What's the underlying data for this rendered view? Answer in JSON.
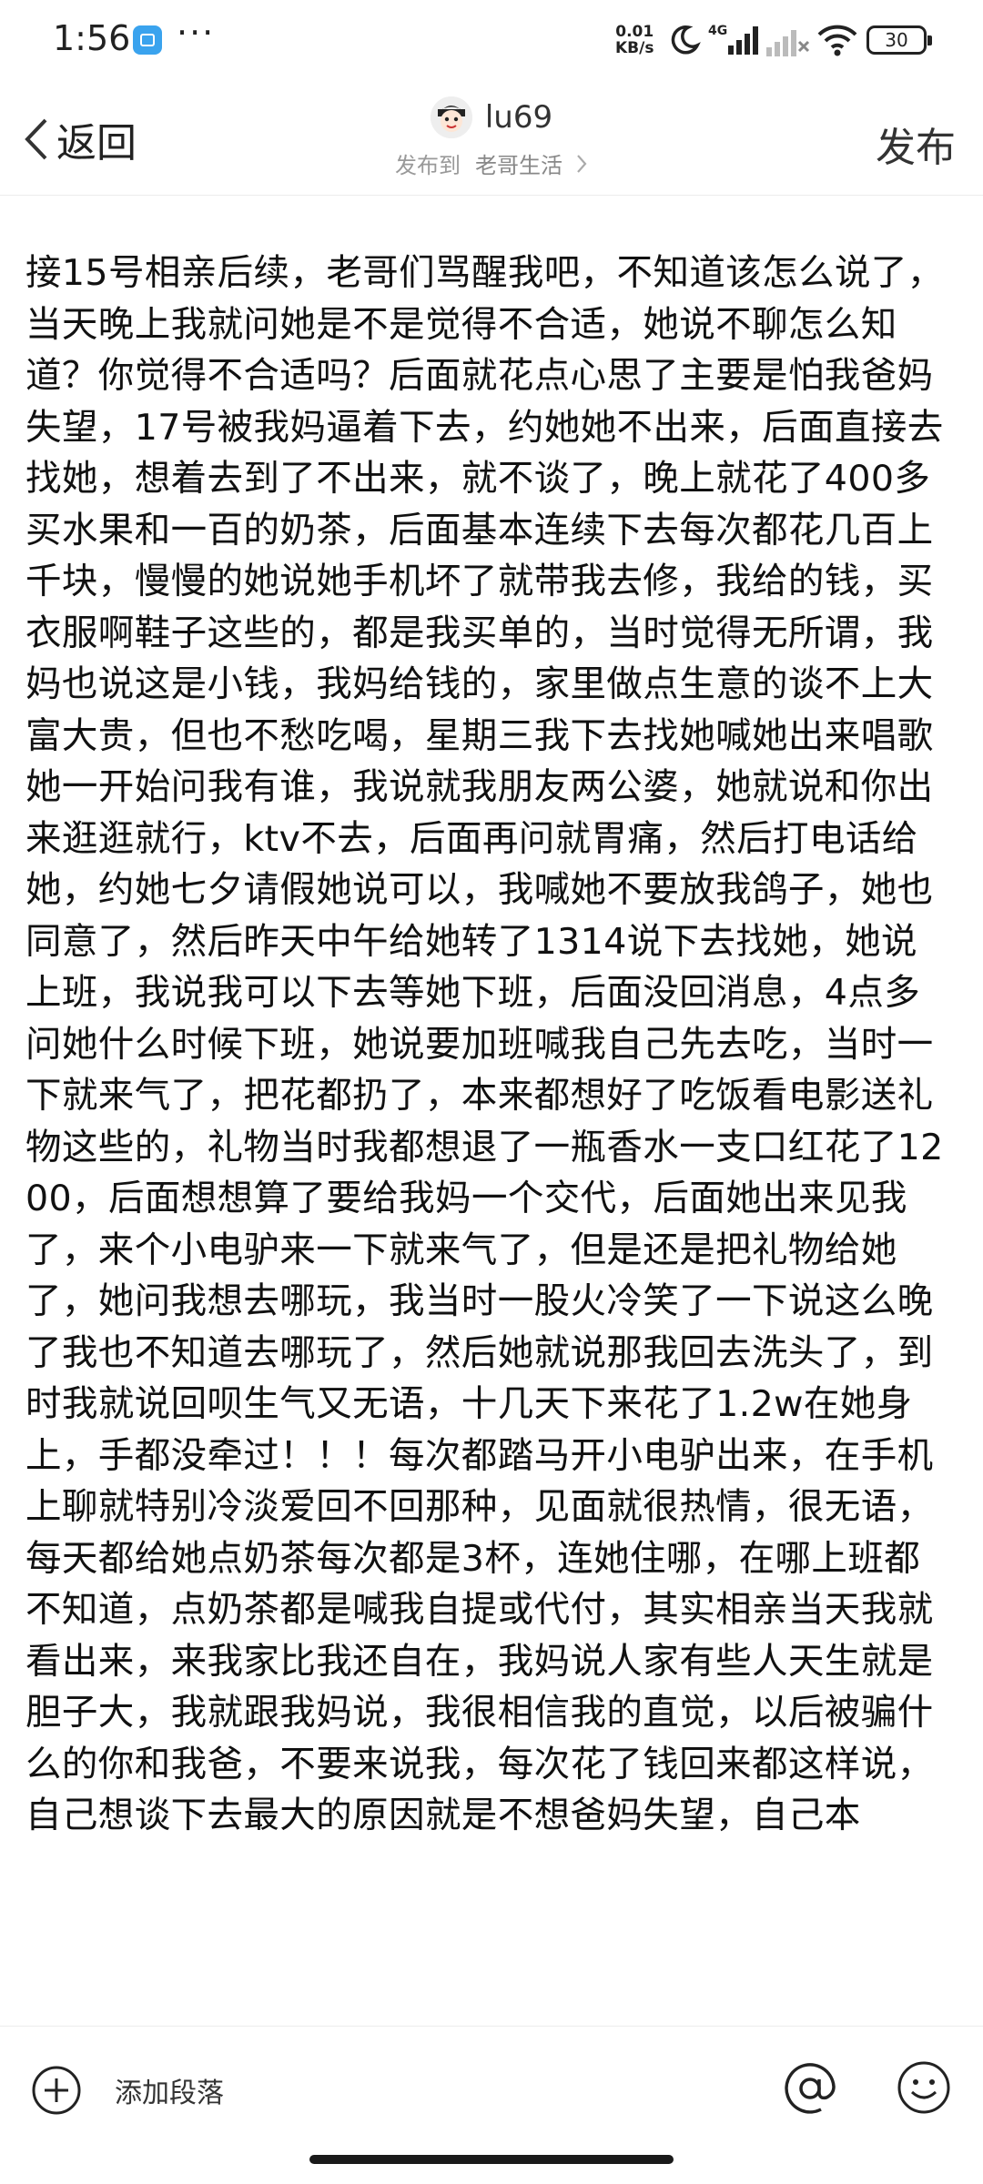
{
  "status_bar": {
    "time": "1:56",
    "more": "···",
    "net_speed_value": "0.01",
    "net_speed_unit": "KB/s",
    "signal_label": "4G",
    "battery": "30"
  },
  "header": {
    "back_label": "返回",
    "author_name": "lu69",
    "publish_prefix": "发布到",
    "destination": "老哥生活",
    "publish_label": "发布"
  },
  "post": {
    "body": "接15号相亲后续，老哥们骂醒我吧，不知道该怎么说了，当天晚上我就问她是不是觉得不合适，她说不聊怎么知道？你觉得不合适吗？后面就花点心思了主要是怕我爸妈失望，17号被我妈逼着下去，约她她不出来，后面直接去找她，想着去到了不出来，就不谈了，晚上就花了400多买水果和一百的奶茶，后面基本连续下去每次都花几百上千块，慢慢的她说她手机坏了就带我去修，我给的钱，买衣服啊鞋子这些的，都是我买单的，当时觉得无所谓，我妈也说这是小钱，我妈给钱的，家里做点生意的谈不上大富大贵，但也不愁吃喝，星期三我下去找她喊她出来唱歌她一开始问我有谁，我说就我朋友两公婆，她就说和你出来逛逛就行，ktv不去，后面再问就胃痛，然后打电话给她，约她七夕请假她说可以，我喊她不要放我鸽子，她也同意了，然后昨天中午给她转了1314说下去找她，她说上班，我说我可以下去等她下班，后面没回消息，4点多问她什么时候下班，她说要加班喊我自己先去吃，当时一下就来气了，把花都扔了，本来都想好了吃饭看电影送礼物这些的，礼物当时我都想退了一瓶香水一支口红花了1200，后面想想算了要给我妈一个交代，后面她出来见我了，来个小电驴来一下就来气了，但是还是把礼物给她了，她问我想去哪玩，我当时一股火冷笑了一下说这么晚了我也不知道去哪玩了，然后她就说那我回去洗头了，到时我就说回呗生气又无语，十几天下来花了1.2w在她身上，手都没牵过！！！每次都踏马开小电驴出来，在手机上聊就特别冷淡爱回不回那种，见面就很热情，很无语，每天都给她点奶茶每次都是3杯，连她住哪，在哪上班都不知道，点奶茶都是喊我自提或代付，其实相亲当天我就看出来，来我家比我还自在，我妈说人家有些人天生就是胆子大，我就跟我妈说，我很相信我的直觉，以后被骗什么的你和我爸，不要来说我，每次花了钱回来都这样说，自己想谈下去最大的原因就是不想爸妈失望，自己本"
  },
  "toolbar": {
    "add_paragraph_label": "添加段落"
  },
  "icons": {
    "back": "chevron-left-icon",
    "destination": "chevron-right-icon",
    "add": "plus-circle-icon",
    "mention": "at-sign-icon",
    "emoji": "smiley-icon"
  }
}
